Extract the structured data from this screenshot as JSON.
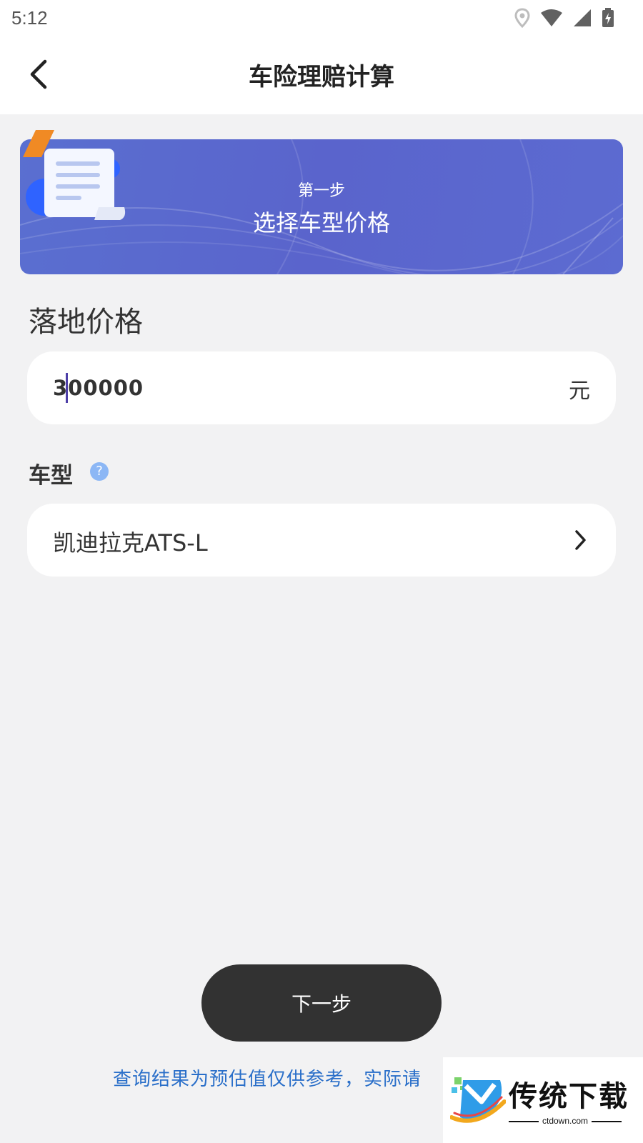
{
  "status_bar": {
    "time": "5:12"
  },
  "header": {
    "title": "车险理赔计算"
  },
  "banner": {
    "step": "第一步",
    "title": "选择车型价格"
  },
  "price": {
    "label": "落地价格",
    "value": "300000",
    "unit": "元"
  },
  "model": {
    "label": "车型",
    "help": "?",
    "value": "凯迪拉克ATS-L"
  },
  "next_button": {
    "label": "下一步"
  },
  "disclaimer": "查询结果为预估值仅供参考，实际请",
  "watermark": {
    "text": "传统下载",
    "sub": "ctdown.com"
  },
  "colors": {
    "banner": "#5a64cc",
    "button": "#323232",
    "disclaimer": "#2a6fc9",
    "help": "#8cb7f5"
  }
}
